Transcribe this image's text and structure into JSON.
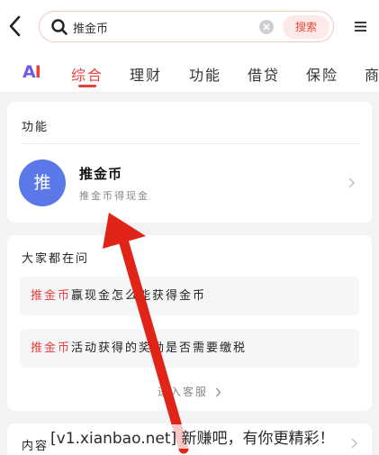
{
  "header": {
    "search_value": "推金币",
    "search_button": "搜索"
  },
  "tabs": {
    "ai_logo_a": "A",
    "ai_logo_i": "I",
    "items": [
      {
        "label": "综合",
        "active": true
      },
      {
        "label": "理财"
      },
      {
        "label": "功能"
      },
      {
        "label": "借贷"
      },
      {
        "label": "保险"
      },
      {
        "label": "商"
      }
    ]
  },
  "function_card": {
    "title": "功能",
    "avatar_text": "推",
    "item_title": "推金币",
    "item_subtitle": "推金币得现金"
  },
  "faq_card": {
    "title": "大家都在问",
    "questions": [
      {
        "highlight": "推金币",
        "rest": "赢现金怎么能获得金币"
      },
      {
        "highlight": "推金币",
        "rest": "活动获得的奖励是否需要缴税"
      }
    ],
    "more_service": "进入客服"
  },
  "content_card": {
    "title": "内容"
  },
  "watermark": "[v1.xianbao.net] 新赚吧，有你更精彩！",
  "colors": {
    "accent": "#e8403a",
    "avatar": "#5b78e8",
    "ai_purple": "#6b5cf0"
  }
}
